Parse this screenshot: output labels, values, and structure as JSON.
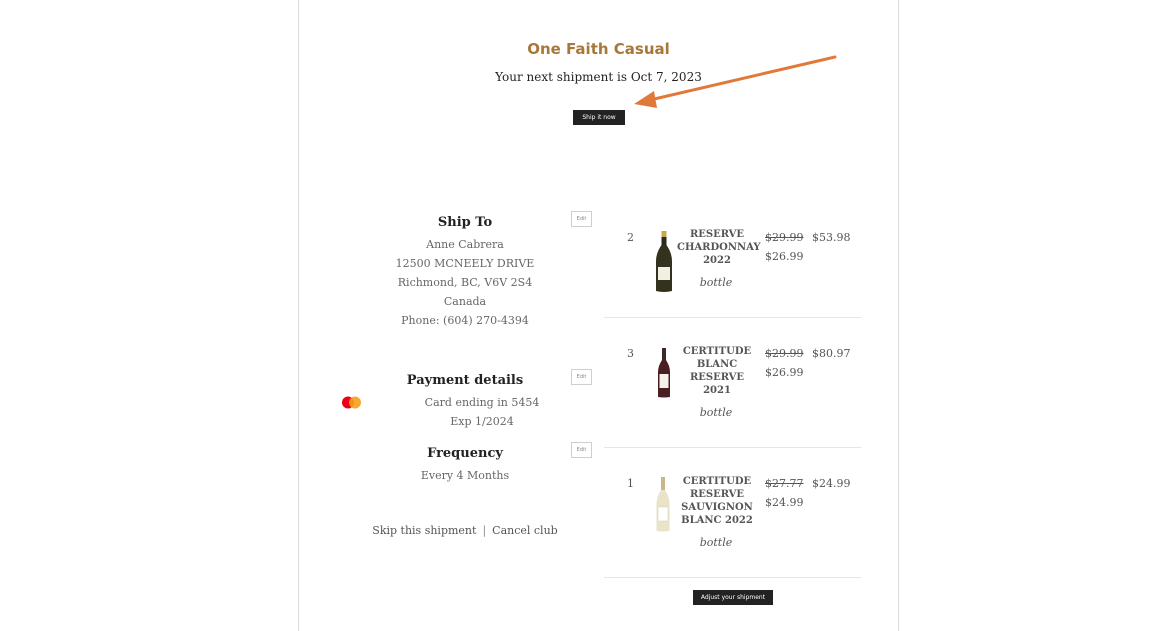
{
  "header": {
    "club_name": "One Faith Casual",
    "next_shipment": "Your next shipment is Oct 7, 2023",
    "ship_now_label": "Ship it now"
  },
  "ship_to": {
    "title": "Ship To",
    "name": "Anne Cabrera",
    "street": "12500 MCNEELY DRIVE",
    "city": "Richmond, BC, V6V 2S4",
    "country": "Canada",
    "phone": "Phone: (604) 270-4394",
    "edit_label": "Edit"
  },
  "payment": {
    "title": "Payment details",
    "card": "Card ending in 5454",
    "exp": "Exp 1/2024",
    "edit_label": "Edit",
    "card_brand_icon": "mastercard-icon"
  },
  "frequency": {
    "title": "Frequency",
    "value": "Every 4 Months",
    "edit_label": "Edit"
  },
  "links": {
    "skip": "Skip this shipment",
    "separator": "|",
    "cancel": "Cancel club"
  },
  "items": [
    {
      "qty": "2",
      "name": [
        "RESERVE",
        "CHARDONNAY",
        "2022"
      ],
      "unit": "bottle",
      "old_price": "$29.99",
      "price": "$26.99",
      "total": "$53.98"
    },
    {
      "qty": "3",
      "name": [
        "CERTITUDE",
        "BLANC",
        "RESERVE",
        "2021"
      ],
      "unit": "bottle",
      "old_price": "$29.99",
      "price": "$26.99",
      "total": "$80.97"
    },
    {
      "qty": "1",
      "name": [
        "CERTITUDE",
        "RESERVE",
        "SAUVIGNON",
        "BLANC 2022"
      ],
      "unit": "bottle",
      "old_price": "$27.77",
      "price": "$24.99",
      "total": "$24.99"
    }
  ],
  "adjust_label": "Adjust your shipment",
  "colors": {
    "accent": "#a8773a",
    "arrow": "#e07a3a",
    "button": "#222222"
  }
}
